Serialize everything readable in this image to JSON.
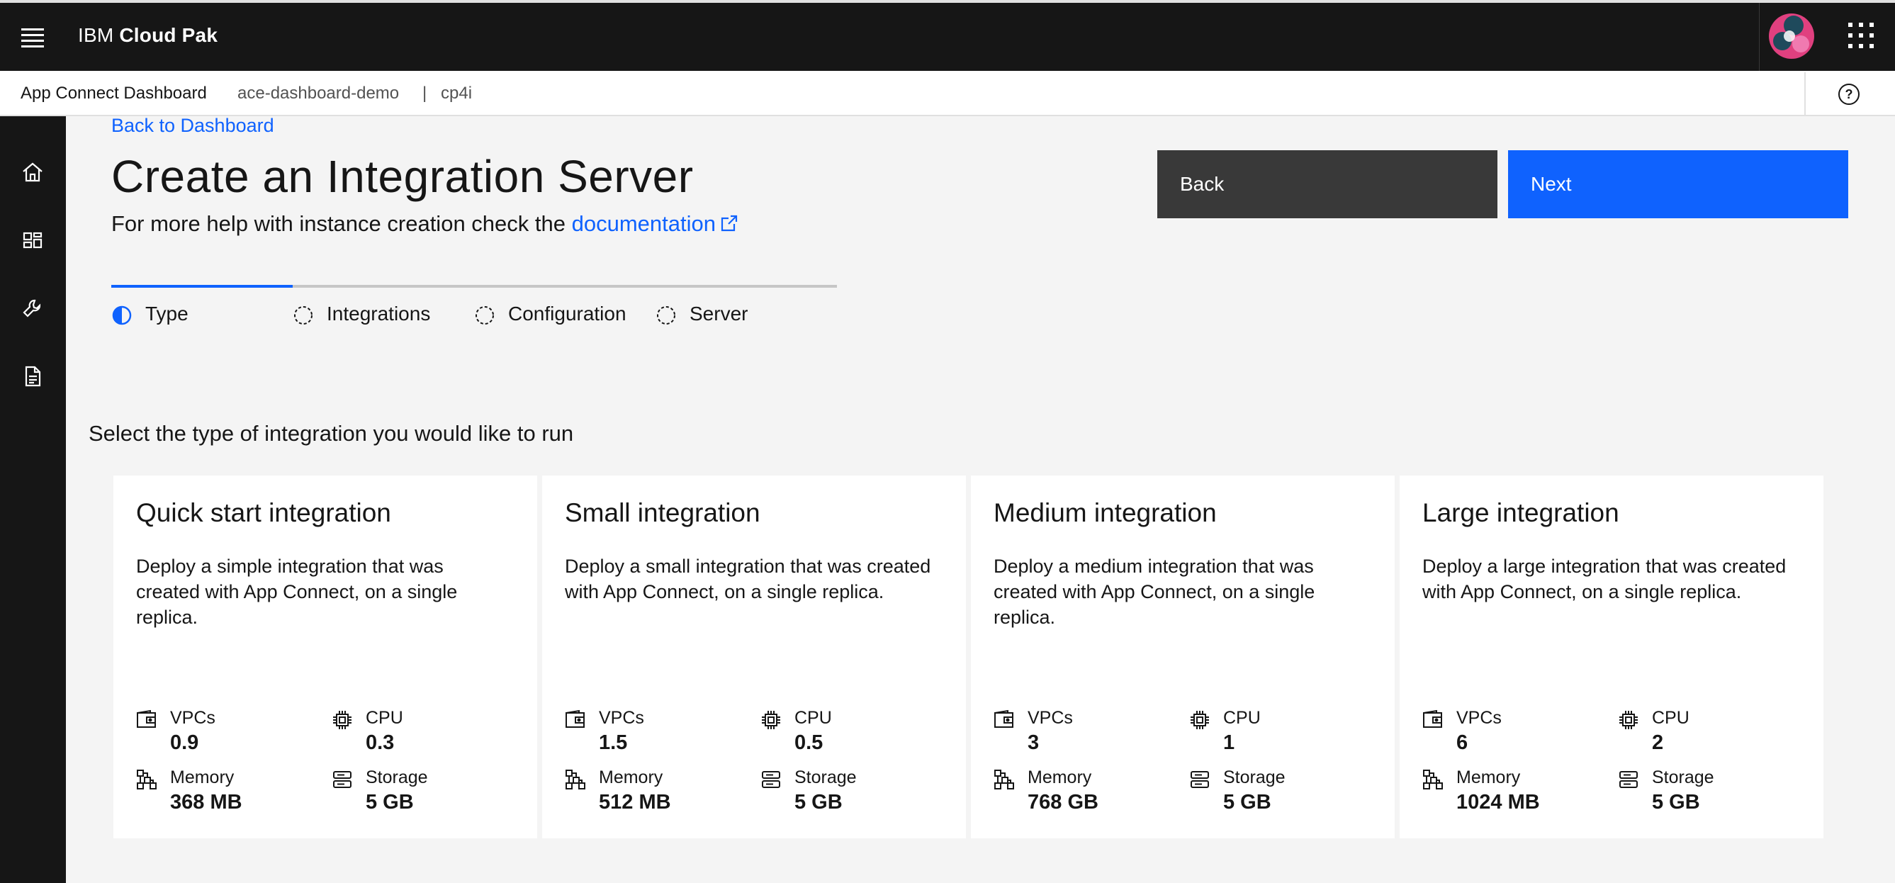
{
  "header": {
    "brand_prefix": "IBM",
    "brand_name": "Cloud Pak"
  },
  "subheader": {
    "app_name": "App Connect Dashboard",
    "instance": "ace-dashboard-demo",
    "separator": "|",
    "namespace": "cp4i"
  },
  "icons": {
    "menu": "menu-icon",
    "avatar": "avatar-icon",
    "app_switcher": "app-switcher-icon",
    "help": "help-icon",
    "rail": [
      "home-icon",
      "dashboard-icon",
      "tools-icon",
      "document-icon"
    ],
    "external_link": "launch-icon"
  },
  "main": {
    "back_link": "Back to Dashboard",
    "title": "Create an Integration Server",
    "help_prefix": "For more help with instance creation check the",
    "help_link": "documentation",
    "buttons": {
      "back": "Back",
      "next": "Next"
    },
    "steps": [
      {
        "label": "Type",
        "state": "current"
      },
      {
        "label": "Integrations",
        "state": "incomplete"
      },
      {
        "label": "Configuration",
        "state": "incomplete"
      },
      {
        "label": "Server",
        "state": "incomplete"
      }
    ],
    "select_label": "Select the type of integration you would like to run"
  },
  "cards": [
    {
      "title": "Quick start integration",
      "description": "Deploy a simple integration that was created with App Connect, on a single replica.",
      "vpcs_label": "VPCs",
      "vpcs": "0.9",
      "cpu_label": "CPU",
      "cpu": "0.3",
      "memory_label": "Memory",
      "memory": "368 MB",
      "storage_label": "Storage",
      "storage": "5 GB"
    },
    {
      "title": "Small integration",
      "description": "Deploy a small integration that was created with App Connect, on a single replica.",
      "vpcs_label": "VPCs",
      "vpcs": "1.5",
      "cpu_label": "CPU",
      "cpu": "0.5",
      "memory_label": "Memory",
      "memory": "512 MB",
      "storage_label": "Storage",
      "storage": "5 GB"
    },
    {
      "title": "Medium integration",
      "description": "Deploy a medium integration that was created with App Connect, on a single replica.",
      "vpcs_label": "VPCs",
      "vpcs": "3",
      "cpu_label": "CPU",
      "cpu": "1",
      "memory_label": "Memory",
      "memory": "768 GB",
      "storage_label": "Storage",
      "storage": "5 GB"
    },
    {
      "title": "Large integration",
      "description": "Deploy a large integration that was created with App Connect, on a single replica.",
      "vpcs_label": "VPCs",
      "vpcs": "6",
      "cpu_label": "CPU",
      "cpu": "2",
      "memory_label": "Memory",
      "memory": "1024 MB",
      "storage_label": "Storage",
      "storage": "5 GB"
    }
  ],
  "colors": {
    "header_bg": "#161616",
    "interactive_blue": "#0f62fe",
    "secondary_button": "#393939",
    "page_bg": "#f4f4f4",
    "avatar_pink": "#e0407f",
    "avatar_teal": "#1f4a5c"
  }
}
